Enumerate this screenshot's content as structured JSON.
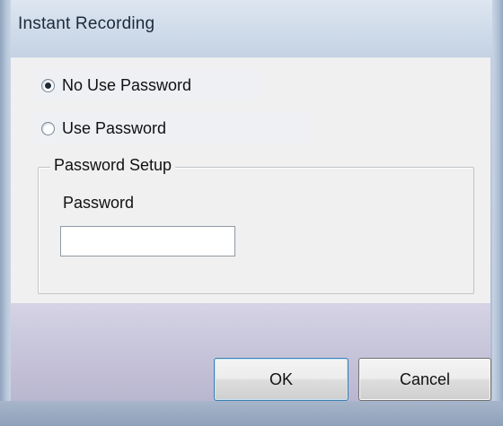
{
  "window": {
    "title": "Instant Recording"
  },
  "options": [
    {
      "label": "No Use Password",
      "selected": true
    },
    {
      "label": "Use Password",
      "selected": false
    }
  ],
  "password_setup": {
    "group_label": "Password Setup",
    "field_label": "Password",
    "value": "",
    "placeholder": ""
  },
  "buttons": {
    "ok_label": "OK",
    "cancel_label": "Cancel"
  }
}
